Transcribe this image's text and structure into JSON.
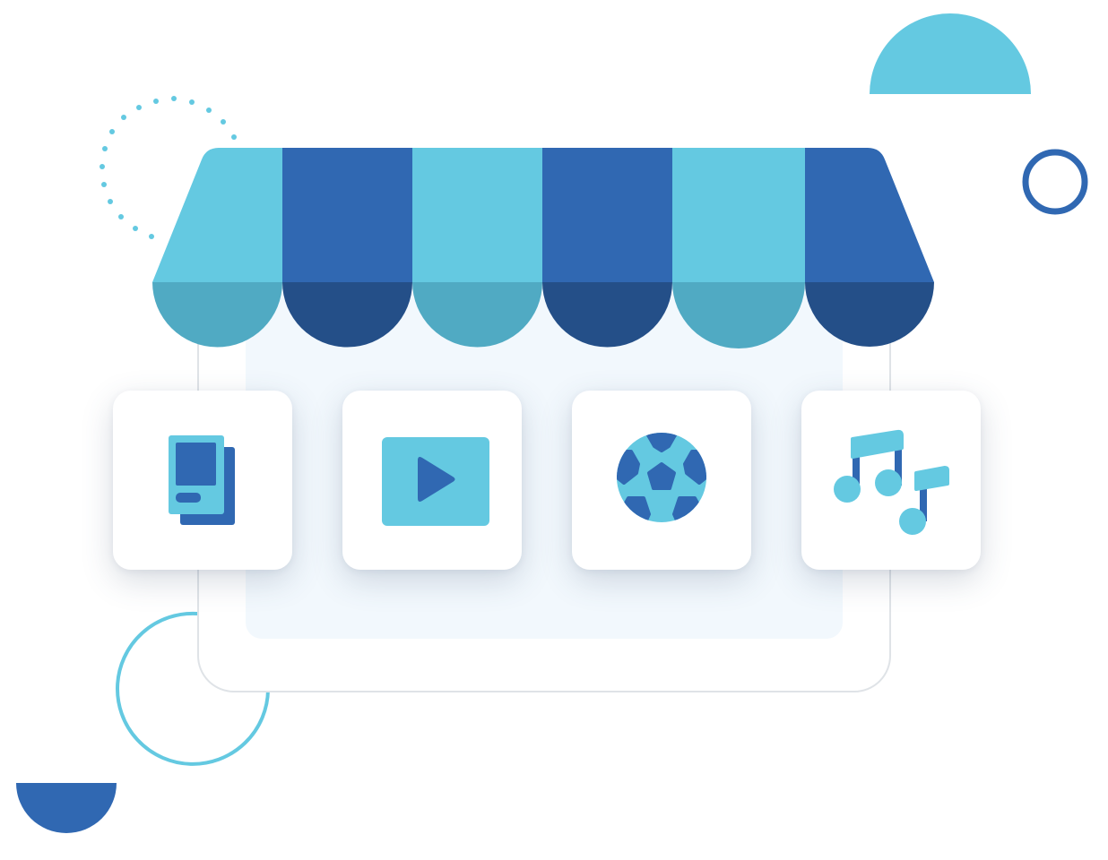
{
  "colors": {
    "light_blue": "#64c9e1",
    "mid_blue": "#3068b2",
    "teal_shade": "#50aac3",
    "dark_blue": "#244f88",
    "storefront_panel": "#f2f8fd",
    "storefront_outline": "#dfe3e7",
    "tile_background": "#ffffff"
  },
  "illustration": {
    "subject": "storefront",
    "awning_stripes": [
      "light_blue",
      "mid_blue",
      "light_blue",
      "mid_blue",
      "light_blue",
      "mid_blue"
    ],
    "product_tiles": [
      {
        "id": "books",
        "icon": "books-icon"
      },
      {
        "id": "video",
        "icon": "video-play-icon"
      },
      {
        "id": "sports",
        "icon": "soccer-ball-icon"
      },
      {
        "id": "music",
        "icon": "music-notes-icon"
      }
    ],
    "decorations": [
      "dotted-arc",
      "light-blue-semicircle",
      "blue-ring",
      "light-blue-ring",
      "blue-semicircle"
    ]
  }
}
